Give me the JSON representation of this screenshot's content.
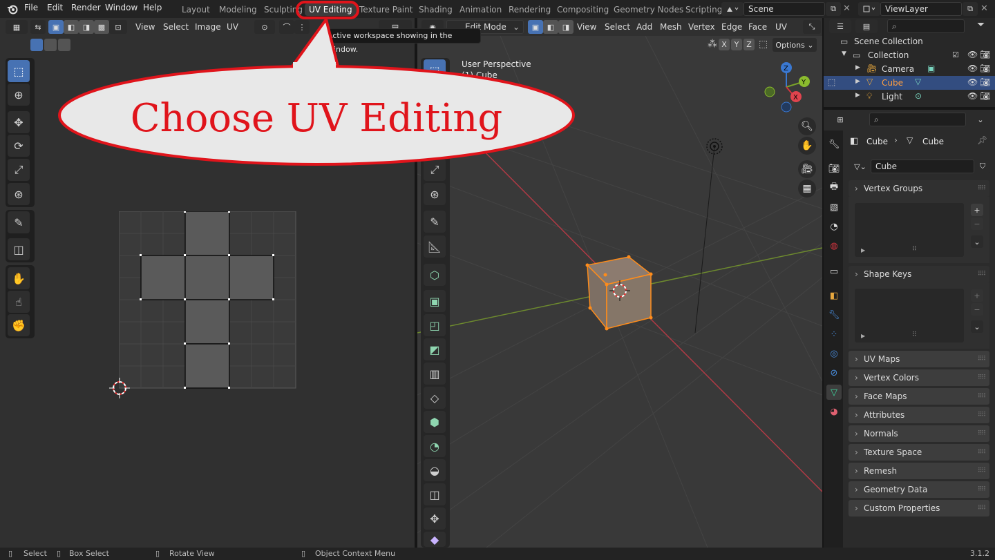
{
  "menu": [
    "File",
    "Edit",
    "Render",
    "Window",
    "Help"
  ],
  "workspaces": [
    "Layout",
    "Modeling",
    "Sculpting",
    "UV Editing",
    "Texture Paint",
    "Shading",
    "Animation",
    "Rendering",
    "Compositing",
    "Geometry Nodes",
    "Scripting"
  ],
  "scene": "Scene",
  "view_layer": "ViewLayer",
  "tooltip": "Active workspace showing in the window.",
  "callout": "Choose UV Editing",
  "uv_editor": {
    "menus": [
      "View",
      "Select",
      "Image",
      "UV"
    ]
  },
  "viewport": {
    "mode": "Edit Mode",
    "menus": [
      "View",
      "Select",
      "Add",
      "Mesh",
      "Vertex",
      "Edge",
      "Face",
      "UV"
    ],
    "overlay_title": "User Perspective",
    "overlay_sub": "(1) Cube",
    "options": "Options",
    "axes": [
      "X",
      "Y",
      "Z"
    ],
    "gizmo": [
      "Z",
      "Y",
      "X"
    ]
  },
  "outliner": {
    "scene_collection": "Scene Collection",
    "collection": "Collection",
    "items": [
      "Camera",
      "Cube",
      "Light"
    ]
  },
  "properties": {
    "breadcrumb_obj": "Cube",
    "breadcrumb_data": "Cube",
    "mesh_name": "Cube",
    "panels_open": [
      "Vertex Groups",
      "Shape Keys"
    ],
    "panels_closed": [
      "UV Maps",
      "Vertex Colors",
      "Face Maps",
      "Attributes",
      "Normals",
      "Texture Space",
      "Remesh",
      "Geometry Data",
      "Custom Properties"
    ]
  },
  "status": {
    "select": "Select",
    "box_select": "Box Select",
    "rotate": "Rotate View",
    "context": "Object Context Menu",
    "version": "3.1.2"
  },
  "colors": {
    "accent": "#4772b3",
    "callout_red": "#e0141b",
    "selected_orange": "#ff8c1a"
  }
}
